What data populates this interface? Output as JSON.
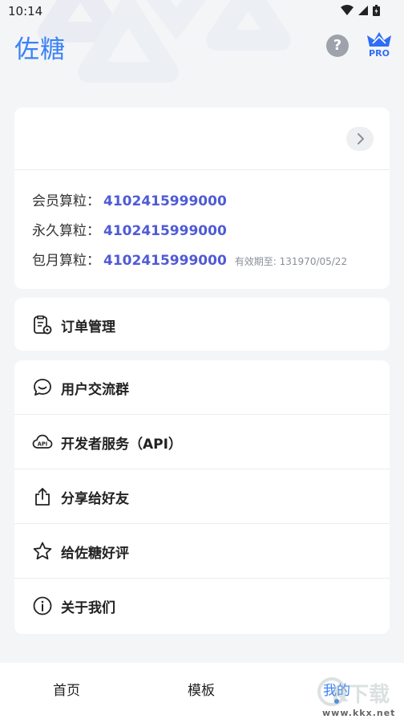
{
  "status_bar": {
    "time": "10:14"
  },
  "header": {
    "title": "佐糖",
    "help_symbol": "?",
    "pro_label": "PRO"
  },
  "member_card": {
    "rows": [
      {
        "label": "会员算粒：",
        "value": "4102415999000",
        "note": ""
      },
      {
        "label": "永久算粒：",
        "value": "4102415999000",
        "note": ""
      },
      {
        "label": "包月算粒：",
        "value": "4102415999000",
        "note": "有效期至: 131970/05/22"
      }
    ]
  },
  "order": {
    "label": "订单管理",
    "icon": "order-settings-icon"
  },
  "menu": {
    "items": [
      {
        "label": "用户交流群",
        "icon": "chat-bubble-icon"
      },
      {
        "label": "开发者服务（API）",
        "icon": "api-cloud-icon"
      },
      {
        "label": "分享给好友",
        "icon": "share-icon"
      },
      {
        "label": "给佐糖好评",
        "icon": "star-icon"
      },
      {
        "label": "关于我们",
        "icon": "info-icon"
      }
    ]
  },
  "bottom_nav": {
    "items": [
      {
        "label": "首页"
      },
      {
        "label": "模板"
      },
      {
        "label": "我的"
      }
    ],
    "active_index": 2
  },
  "watermark": {
    "text": "www.kkx.net",
    "logo_text": "K下载"
  },
  "colors": {
    "accent": "#3b82f6",
    "quota_value": "#4f5bd5",
    "background": "#f4f5f7"
  }
}
